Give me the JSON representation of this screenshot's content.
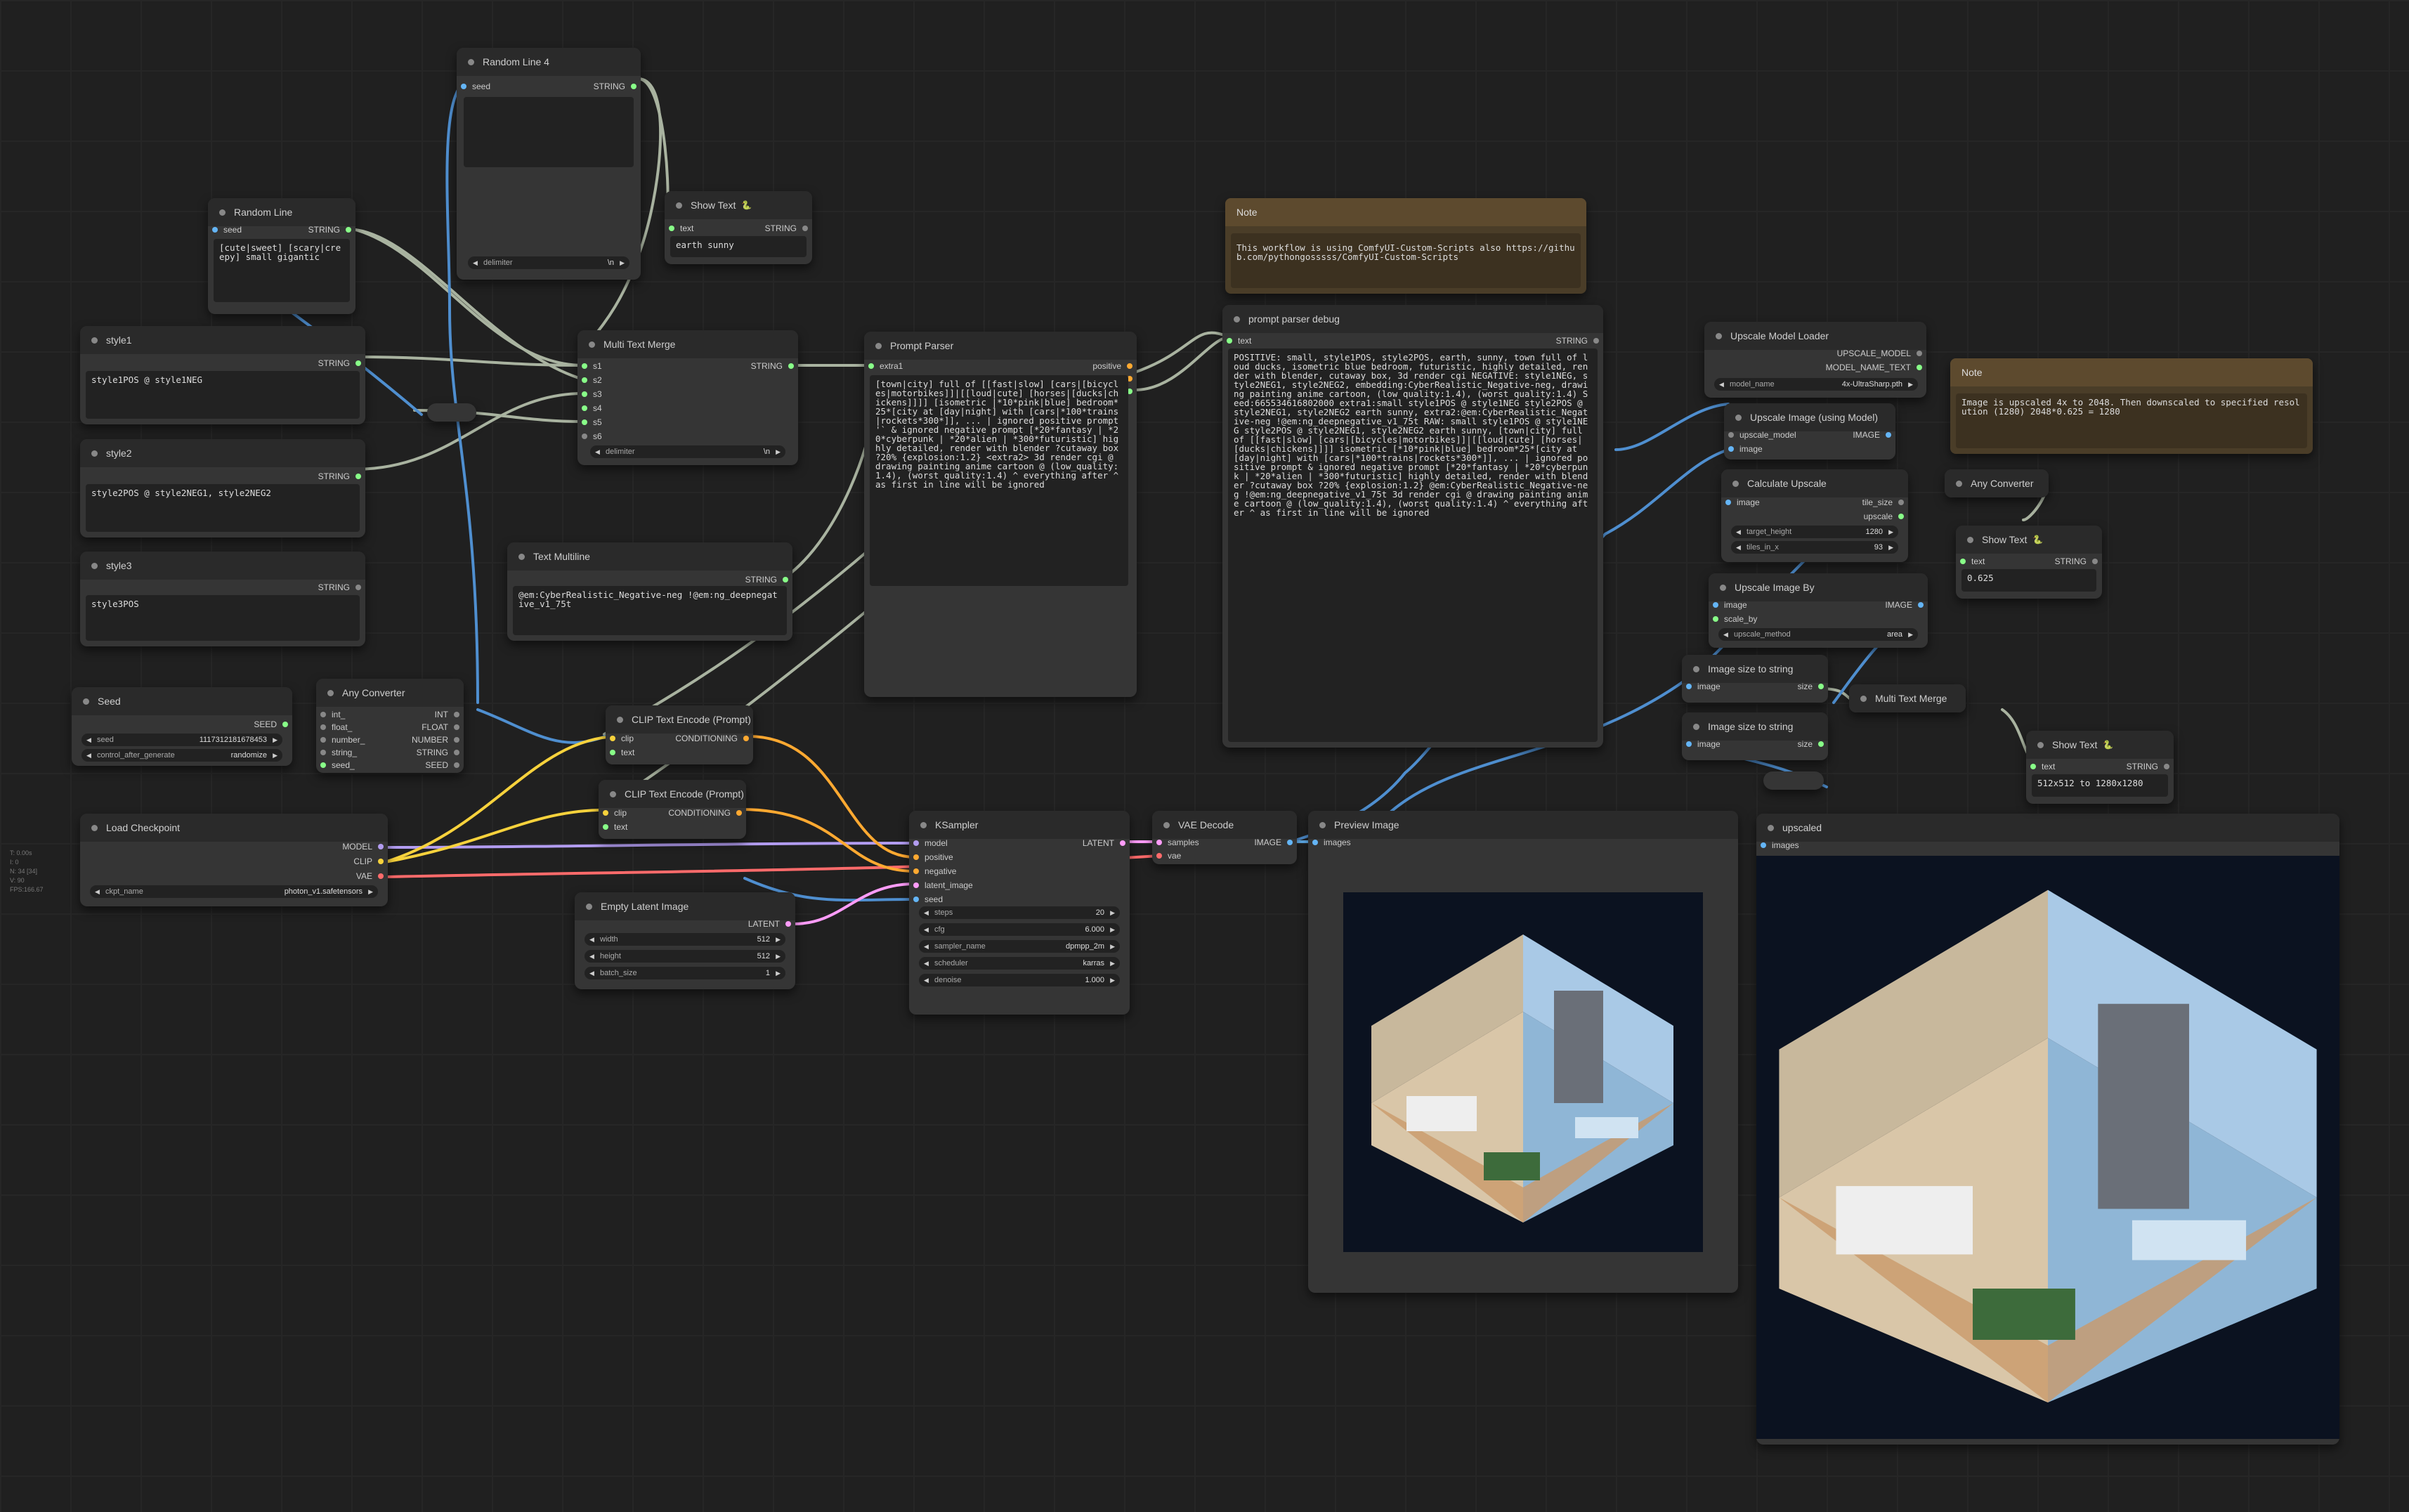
{
  "stats": [
    "T: 0.00s",
    "I: 0",
    "N: 34 [34]",
    "V: 90",
    "FPS:166.67"
  ],
  "nodes": {
    "random_line_4": {
      "title": "Random Line 4",
      "in": "seed",
      "out": "STRING",
      "w_label": "delimiter",
      "w_value": "\\n"
    },
    "random_line": {
      "title": "Random Line",
      "in": "seed",
      "out": "STRING",
      "text": "[cute|sweet] [scary|creepy] small gigantic"
    },
    "show_text_1": {
      "title": "Show Text",
      "in": "text",
      "out": "STRING",
      "text": "earth sunny"
    },
    "style1": {
      "title": "style1",
      "out": "STRING",
      "text": "style1POS @ style1NEG"
    },
    "style2": {
      "title": "style2",
      "out": "STRING",
      "text": "style2POS @ style2NEG1, style2NEG2"
    },
    "style3": {
      "title": "style3",
      "out": "STRING",
      "text": "style3POS"
    },
    "multi_text_merge": {
      "title": "Multi Text Merge",
      "ins": [
        "s1",
        "s2",
        "s3",
        "s4",
        "s5",
        "s6"
      ],
      "out": "STRING",
      "w_label": "delimiter",
      "w_value": "\\n"
    },
    "text_multiline": {
      "title": "Text Multiline",
      "out": "STRING",
      "text": "@em:CyberRealistic_Negative-neg !@em:ng_deepnegative_v1_75t"
    },
    "prompt_parser": {
      "title": "Prompt Parser",
      "in": "extra1",
      "outs": [
        "positive",
        "negative",
        "debug"
      ],
      "text": "[town|city] full of [[fast|slow] [cars|[bicycles|motorbikes]]|[[loud|cute] [horses|[ducks|chickens]]]] [isometric |*10*pink|blue] bedroom*25*[city at [day|night] with [cars|*100*trains|rockets*300*]], ... | ignored positive prompt '` & ignored negative prompt [*20*fantasy | *20*cyberpunk | *20*alien | *300*futuristic] highly detailed, render with blender ?cutaway box ?20% {explosion:1.2} <extra2> 3d render cgi @ drawing painting anime cartoon @ (low_quality:1.4), (worst quality:1.4) ^ everything after ^ as first in line will be ignored"
    },
    "prompt_parser_debug": {
      "title": "prompt parser debug",
      "in": "text",
      "out": "STRING",
      "text": "POSITIVE: small, style1POS, style2POS, earth, sunny, town full of loud ducks, isometric blue bedroom, futuristic, highly detailed, render with blender, cutaway box, 3d render cgi NEGATIVE: style1NEG, style2NEG1, style2NEG2, embedding:CyberRealistic_Negative-neg, drawing painting anime cartoon, (low quality:1.4), (worst quality:1.4) Seed:665534616802000 extra1:small style1POS @ style1NEG style2POS @ style2NEG1, style2NEG2 earth sunny, extra2:@em:CyberRealistic_Negative-neg !@em:ng_deepnegative_v1_75t RAW: small style1POS @ style1NEG style2POS @ style2NEG1, style2NEG2 earth sunny, [town|city] full of [[fast|slow] [cars|[bicycles|motorbikes]]|[[loud|cute] [horses|[ducks|chickens]]]] isometric [*10*pink|blue] bedroom*25*[city at [day|night] with [cars|*100*trains|rockets*300*]], ... | ignored positive prompt & ignored negative prompt [*20*fantasy | *20*cyberpunk | *20*alien | *300*futuristic] highly detailed, render with blender ?cutaway box ?20% {explosion:1.2} @em:CyberRealistic_Negative-neg !@em:ng_deepnegative_v1_75t 3d render cgi @ drawing painting anime cartoon @ (low_quality:1.4), (worst quality:1.4) ^ everything after ^ as first in line will be ignored"
    },
    "note1": {
      "title": "Note",
      "text": "This workflow is using ComfyUI-Custom-Scripts also https://github.com/pythongosssss/ComfyUI-Custom-Scripts"
    },
    "seed": {
      "title": "Seed",
      "out": "SEED",
      "w1_label": "seed",
      "w1_value": "1117312181678453",
      "w2_label": "control_after_generate",
      "w2_value": "randomize"
    },
    "any_converter_1": {
      "title": "Any Converter",
      "ins": [
        "int_",
        "float_",
        "number_",
        "string_",
        "seed_"
      ],
      "outs": [
        "INT",
        "FLOAT",
        "NUMBER",
        "STRING",
        "SEED"
      ]
    },
    "clip_encode_1": {
      "title": "CLIP Text Encode (Prompt)",
      "ins": [
        "clip",
        "text"
      ],
      "out": "CONDITIONING"
    },
    "clip_encode_2": {
      "title": "CLIP Text Encode (Prompt)",
      "ins": [
        "clip",
        "text"
      ],
      "out": "CONDITIONING"
    },
    "load_checkpoint": {
      "title": "Load Checkpoint",
      "outs": [
        "MODEL",
        "CLIP",
        "VAE"
      ],
      "w_label": "ckpt_name",
      "w_value": "photon_v1.safetensors"
    },
    "empty_latent": {
      "title": "Empty Latent Image",
      "out": "LATENT",
      "widgets": [
        {
          "label": "width",
          "value": "512"
        },
        {
          "label": "height",
          "value": "512"
        },
        {
          "label": "batch_size",
          "value": "1"
        }
      ]
    },
    "ksampler": {
      "title": "KSampler",
      "ins": [
        "model",
        "positive",
        "negative",
        "latent_image",
        "seed"
      ],
      "out": "LATENT",
      "widgets": [
        {
          "label": "steps",
          "value": "20"
        },
        {
          "label": "cfg",
          "value": "6.000"
        },
        {
          "label": "sampler_name",
          "value": "dpmpp_2m"
        },
        {
          "label": "scheduler",
          "value": "karras"
        },
        {
          "label": "denoise",
          "value": "1.000"
        }
      ]
    },
    "vae_decode": {
      "title": "VAE Decode",
      "ins": [
        "samples",
        "vae"
      ],
      "out": "IMAGE"
    },
    "preview_image": {
      "title": "Preview Image",
      "in": "images"
    },
    "upscaled": {
      "title": "upscaled",
      "in": "images"
    },
    "upscale_model_loader": {
      "title": "Upscale Model Loader",
      "outs": [
        "UPSCALE_MODEL",
        "MODEL_NAME_TEXT"
      ],
      "w_label": "model_name",
      "w_value": "4x-UltraSharp.pth"
    },
    "upscale_using_model": {
      "title": "Upscale Image (using Model)",
      "ins": [
        "upscale_model",
        "image"
      ],
      "out": "IMAGE"
    },
    "calculate_upscale": {
      "title": "Calculate Upscale",
      "in": "image",
      "outs": [
        "tile_size",
        "upscale"
      ],
      "widgets": [
        {
          "label": "target_height",
          "value": "1280"
        },
        {
          "label": "tiles_in_x",
          "value": "93"
        }
      ]
    },
    "note2": {
      "title": "Note",
      "text": "Image is upscaled 4x to 2048. Then downscaled to specified resolution (1280) 2048*0.625 = 1280"
    },
    "any_converter_2": {
      "title": "Any Converter"
    },
    "show_text_2": {
      "title": "Show Text",
      "in": "text",
      "out": "STRING",
      "text": "0.625"
    },
    "upscale_image_by": {
      "title": "Upscale Image By",
      "ins": [
        "image",
        "scale_by"
      ],
      "out": "IMAGE",
      "w_label": "upscale_method",
      "w_value": "area"
    },
    "image_size_1": {
      "title": "Image size to string",
      "in": "image",
      "out": "size"
    },
    "image_size_2": {
      "title": "Image size to string",
      "in": "image",
      "out": "size"
    },
    "multi_text_merge_2": {
      "title": "Multi Text Merge"
    },
    "show_text_3": {
      "title": "Show Text",
      "in": "text",
      "out": "STRING",
      "text": "512x512 to 1280x1280"
    }
  },
  "colors": {
    "string": "#7cd87c",
    "model": "#b29cf0",
    "clip": "#f7d23c",
    "vae": "#ff6b6b",
    "latent": "#ff9cf9",
    "image": "#64b5f6",
    "conditioning": "#ffa931"
  }
}
